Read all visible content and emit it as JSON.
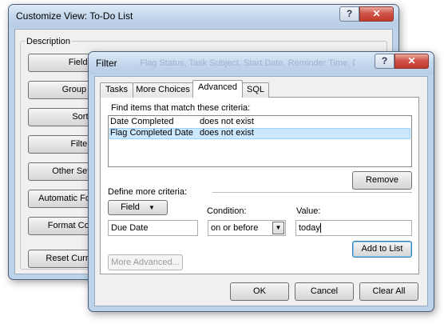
{
  "back_dialog": {
    "title": "Customize View: To-Do List",
    "help_label": "?",
    "close_label": "✕",
    "group_label": "Description",
    "buttons": [
      {
        "label": "Fields..."
      },
      {
        "label": "Group By..."
      },
      {
        "label": "Sort..."
      },
      {
        "label": "Filter..."
      },
      {
        "label": "Other Settings..."
      },
      {
        "label": "Automatic Formatting..."
      },
      {
        "label": "Format Columns..."
      },
      {
        "label": "Reset Current View"
      }
    ],
    "description_preview": "Flag Status, Task Subject, Start Date, Reminder Time, Due..."
  },
  "filter_dialog": {
    "title": "Filter",
    "help_label": "?",
    "close_label": "✕",
    "tabs": [
      "Tasks",
      "More Choices",
      "Advanced",
      "SQL"
    ],
    "active_tab": "Advanced",
    "criteria_heading": "Find items that match these criteria:",
    "criteria": [
      {
        "field": "Date Completed",
        "condition": "does not exist",
        "selected": false
      },
      {
        "field": "Flag Completed Date",
        "condition": "does not exist",
        "selected": true
      }
    ],
    "remove_label": "Remove",
    "define_label": "Define more criteria:",
    "field_button_label": "Field",
    "condition_label": "Condition:",
    "value_label": "Value:",
    "field_value": "Due Date",
    "condition_value": "on or before",
    "value_value": "today",
    "add_to_list_label": "Add to List",
    "more_advanced_label": "More Advanced...",
    "ok_label": "OK",
    "cancel_label": "Cancel",
    "clear_all_label": "Clear All"
  },
  "colors": {
    "selection": "#cce8ff",
    "frame": "#bcd3ea",
    "close_red": "#c0392b"
  }
}
